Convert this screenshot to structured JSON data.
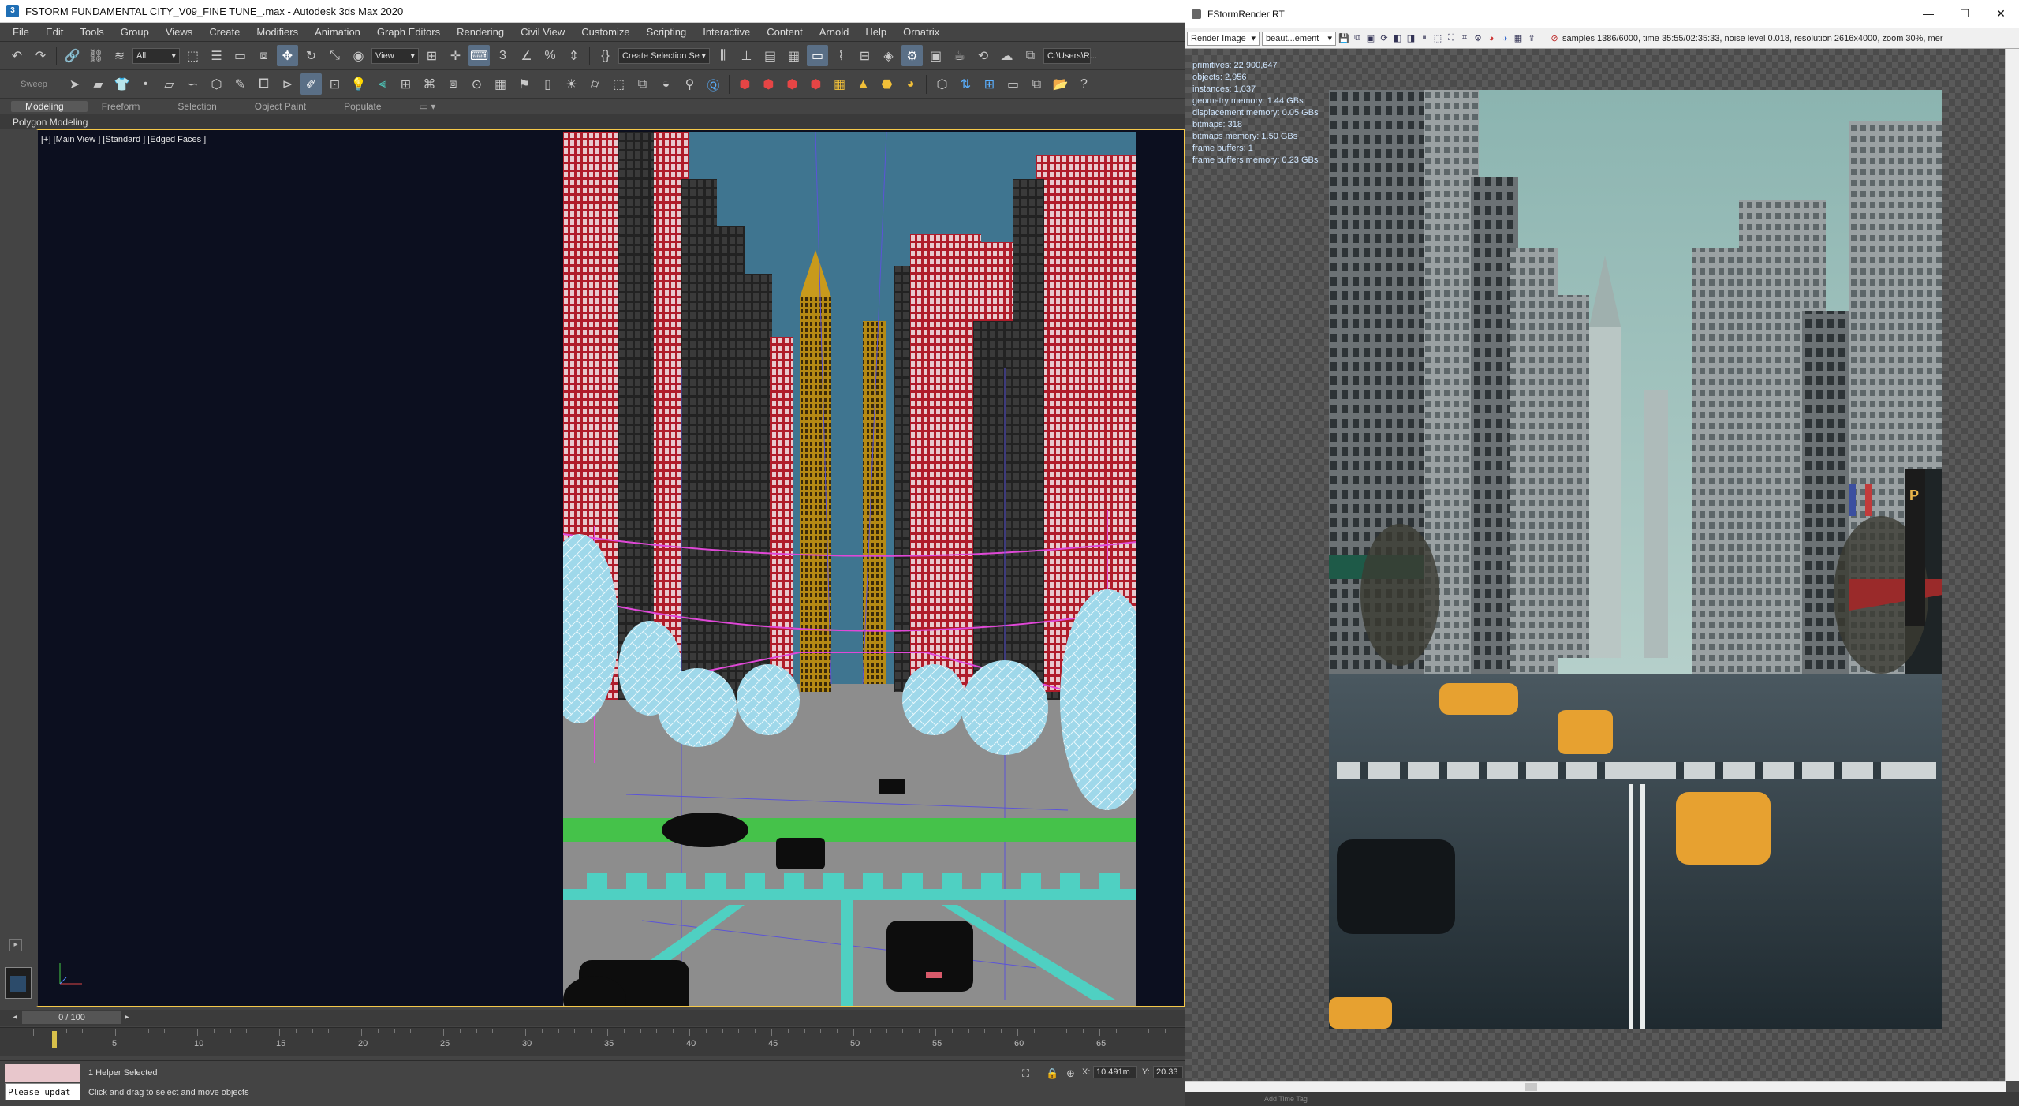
{
  "max": {
    "title": "FSTORM FUNDAMENTAL CITY_V09_FINE TUNE_.max - Autodesk 3ds Max 2020",
    "menu": [
      "File",
      "Edit",
      "Tools",
      "Group",
      "Views",
      "Create",
      "Modifiers",
      "Animation",
      "Graph Editors",
      "Rendering",
      "Civil View",
      "Customize",
      "Scripting",
      "Interactive",
      "Content",
      "Arnold",
      "Help",
      "Ornatrix"
    ],
    "toolbar": {
      "selection_filter": "All",
      "ref_coord": "View",
      "named_selection": "Create Selection Se",
      "path": "C:\\Users\\R..."
    },
    "ribbon_tabs": [
      "Modeling",
      "Freeform",
      "Selection",
      "Object Paint",
      "Populate"
    ],
    "ribbon_active": "Modeling",
    "ribbon_panel": "Polygon Modeling",
    "sweep_label": "Sweep",
    "viewport_label": "[+] [Main View ] [Standard ] [Edged Faces ]",
    "time_slider": "0 / 100",
    "ruler_labels": [
      "5",
      "10",
      "15",
      "20",
      "25",
      "30",
      "35",
      "40",
      "45",
      "50",
      "55",
      "60",
      "65"
    ],
    "status": {
      "selected": "1 Helper Selected",
      "hint": "Click and drag to select and move objects",
      "script": "Please updat",
      "x_label": "X:",
      "x_value": "10.491m",
      "y_label": "Y:",
      "y_value": "20.33"
    },
    "accent": "#f6c94a"
  },
  "fstorm": {
    "title": "FStormRender RT",
    "render_image_dd": "Render Image",
    "element_dd": "beaut...ement",
    "status_line": "samples 1386/6000,  time 35:55/02:35:33,  noise level 0.018,  resolution 2616x4000,  zoom 30%,  mer",
    "stats": [
      "primitives: 22,900,647",
      "objects: 2,956",
      "instances: 1,037",
      "geometry memory: 1.44 GBs",
      "displacement memory: 0.05 GBs",
      "bitmaps: 318",
      "bitmaps memory: 1.50 GBs",
      "frame buffers: 1",
      "frame buffers memory: 0.23 GBs"
    ],
    "bottom_text": "Add Time Tag",
    "window_controls": [
      "—",
      "☐",
      "✕"
    ]
  }
}
